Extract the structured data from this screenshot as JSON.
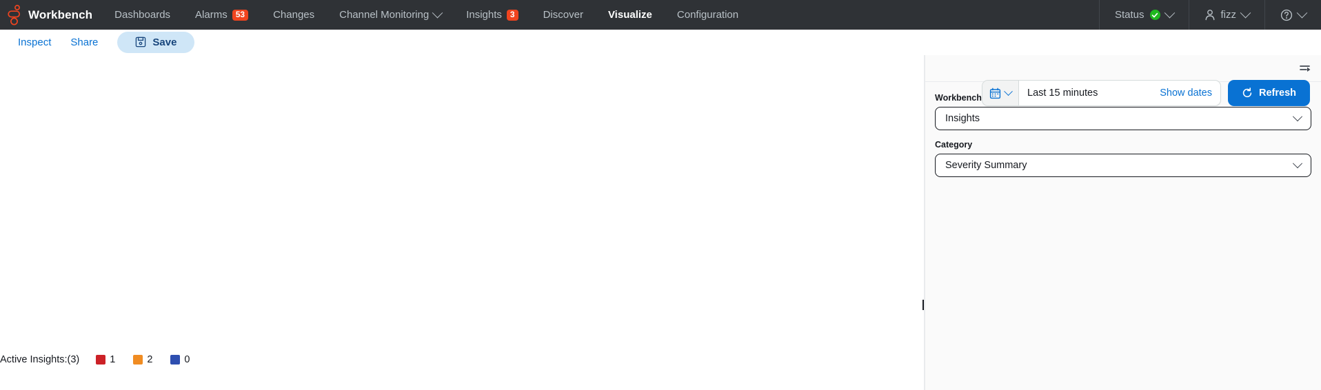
{
  "topnav": {
    "brand": "Workbench",
    "logo_color": "#f0441f",
    "background": "#2f3236",
    "items": [
      {
        "label": "Dashboards",
        "badge": null,
        "has_chevron": false,
        "active": false
      },
      {
        "label": "Alarms",
        "badge": "53",
        "has_chevron": false,
        "active": false
      },
      {
        "label": "Changes",
        "badge": null,
        "has_chevron": false,
        "active": false
      },
      {
        "label": "Channel Monitoring",
        "badge": null,
        "has_chevron": true,
        "active": false
      },
      {
        "label": "Insights",
        "badge": "3",
        "has_chevron": false,
        "active": false
      },
      {
        "label": "Discover",
        "badge": null,
        "has_chevron": false,
        "active": false
      },
      {
        "label": "Visualize",
        "badge": null,
        "has_chevron": false,
        "active": true
      },
      {
        "label": "Configuration",
        "badge": null,
        "has_chevron": false,
        "active": false
      }
    ],
    "badge_color": "#f0441f",
    "utils": {
      "status_label": "Status",
      "status_color": "#1fb81f",
      "user_label": "fizz",
      "help_label": ""
    }
  },
  "toolbar": {
    "inspect_label": "Inspect",
    "share_label": "Share",
    "save_label": "Save",
    "save_bg": "#cfe6f7",
    "link_color": "#0972d3"
  },
  "datepicker": {
    "value": "Last 15 minutes",
    "show_dates_label": "Show dates",
    "refresh_label": "Refresh",
    "refresh_color": "#0972d3"
  },
  "panel": {
    "viz_type_label": "Workbench Visualization Type",
    "viz_type_value": "Insights",
    "category_label": "Category",
    "category_value": "Severity Summary"
  },
  "legend": {
    "title": "Active Insights:(3)",
    "entries": [
      {
        "color": "#cc2127",
        "value": "1"
      },
      {
        "color": "#f08c22",
        "value": "2"
      },
      {
        "color": "#2e4fb0",
        "value": "0"
      }
    ]
  }
}
